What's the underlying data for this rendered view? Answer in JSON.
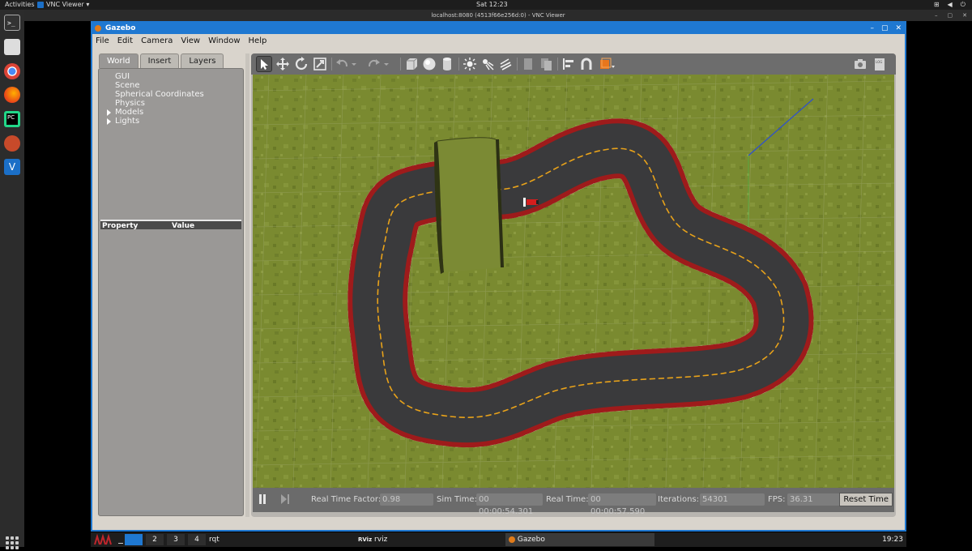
{
  "topbar": {
    "activities": "Activities",
    "app_name": "VNC Viewer ▾",
    "clock": "Sat 12:23"
  },
  "vnc": {
    "title": "localhost:8080 (4513f66e256d:0) - VNC Viewer"
  },
  "gazebo": {
    "title": "Gazebo",
    "menu": [
      "File",
      "Edit",
      "Camera",
      "View",
      "Window",
      "Help"
    ],
    "tabs": [
      "World",
      "Insert",
      "Layers"
    ],
    "active_tab": "World",
    "tree": [
      "GUI",
      "Scene",
      "Spherical Coordinates",
      "Physics",
      "Models",
      "Lights"
    ],
    "tree_expandable": [
      "Models",
      "Lights"
    ],
    "property_header": "Property",
    "value_header": "Value",
    "toolbar_icons": [
      "select-arrow-icon",
      "translate-icon",
      "rotate-icon",
      "scale-icon",
      "undo-icon",
      "redo-icon",
      "box-icon",
      "sphere-icon",
      "cylinder-icon",
      "point-light-icon",
      "spot-light-icon",
      "directional-light-icon",
      "copy-icon",
      "paste-icon",
      "align-icon",
      "snap-icon",
      "view-angle-icon",
      "screenshot-icon",
      "log-icon"
    ],
    "status": {
      "real_time_factor_label": "Real Time Factor:",
      "real_time_factor": "0.98",
      "sim_time_label": "Sim Time:",
      "sim_time": "00 00:00:54.301",
      "real_time_label": "Real Time:",
      "real_time": "00 00:00:57.590",
      "iterations_label": "Iterations:",
      "iterations": "54301",
      "fps_label": "FPS:",
      "fps": "36.31",
      "reset_label": "Reset Time"
    }
  },
  "taskbar": {
    "workspaces": [
      "2",
      "3",
      "4"
    ],
    "rqt_label": "rqt",
    "rviz_label": "rviz",
    "gazebo_label": "Gazebo",
    "clock": "19:23"
  },
  "colors": {
    "accent": "#1f78d1",
    "grass": "#79892f",
    "road": "#3a3a3c",
    "curb_red": "#9e1b1b",
    "lane_line": "#e8a21a"
  }
}
